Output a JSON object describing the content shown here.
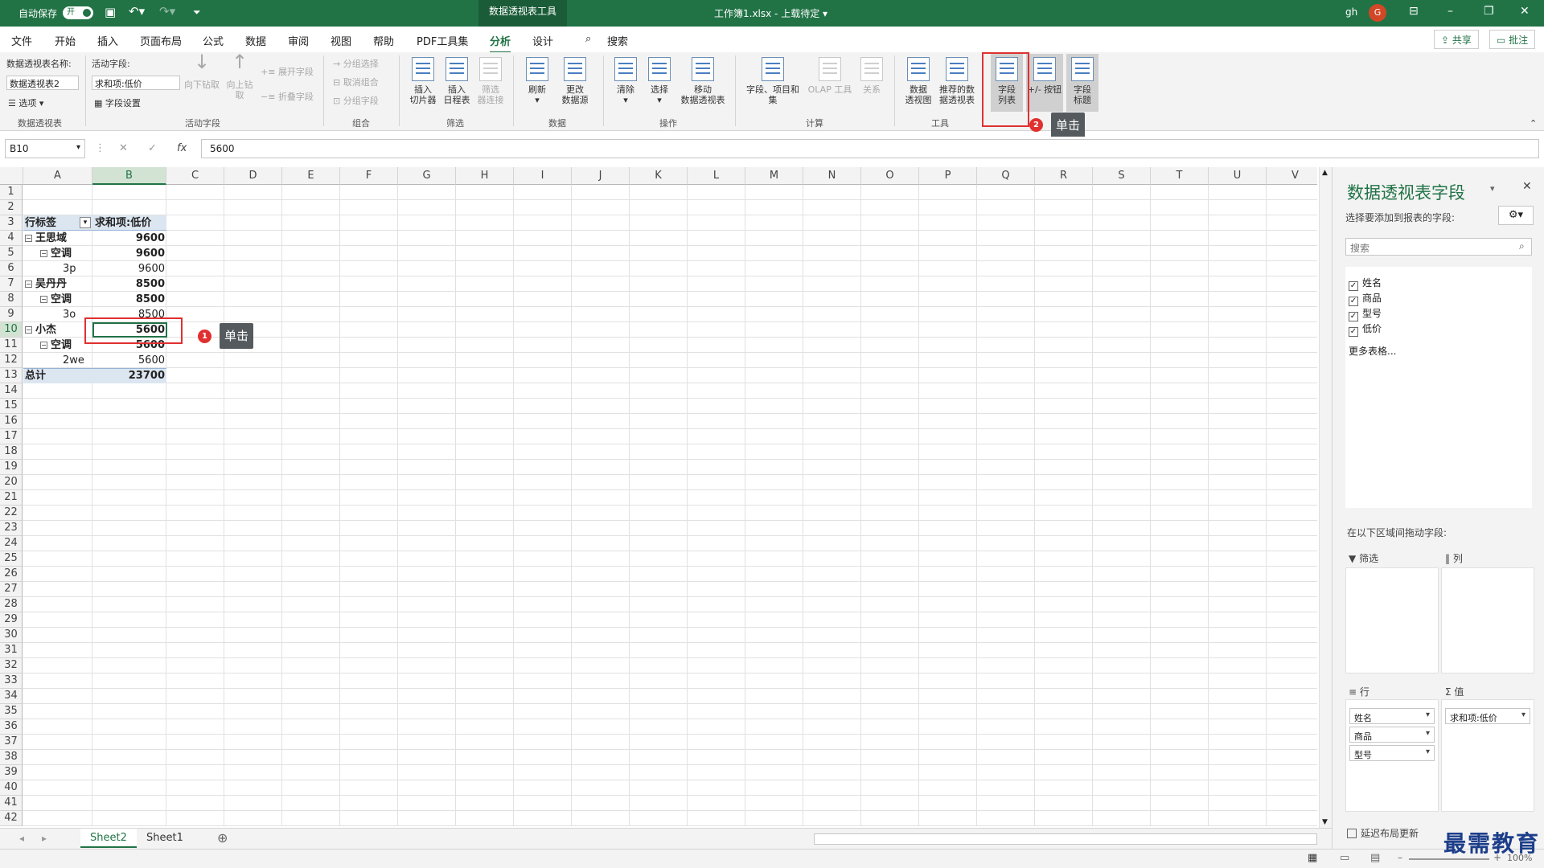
{
  "titlebar": {
    "autosave_label": "自动保存",
    "autosave_state": "开",
    "context_tab": "数据透视表工具",
    "document_title": "工作簿1.xlsx - 上载待定 ▾",
    "user_initials": "gh",
    "avatar_letter": "G"
  },
  "menu": {
    "tabs": [
      "文件",
      "开始",
      "插入",
      "页面布局",
      "公式",
      "数据",
      "审阅",
      "视图",
      "帮助",
      "PDF工具集",
      "分析",
      "设计"
    ],
    "active_tab": "分析",
    "search": "搜索",
    "share": "共享",
    "comment": "批注"
  },
  "ribbon": {
    "pt_name_label": "数据透视表名称:",
    "pt_name_value": "数据透视表2",
    "options": "选项",
    "active_field_label": "活动字段:",
    "active_field_value": "求和项:低价",
    "field_settings": "字段设置",
    "drill_down": "向下钻取",
    "drill_up_1": "向上钻",
    "drill_up_2": "取",
    "expand_field": "展开字段",
    "collapse_field": "折叠字段",
    "group_selection": "分组选择",
    "ungroup": "取消组合",
    "group_field": "分组字段",
    "insert_slicer": "插入\n切片器",
    "insert_timeline": "插入\n日程表",
    "filter_connections": "筛选\n器连接",
    "refresh": "刷新",
    "change_source": "更改\n数据源",
    "clear": "清除",
    "select": "选择",
    "move_pt": "移动\n数据透视表",
    "fields_items": "字段、项目和\n集",
    "olap": "OLAP 工具",
    "relations": "关系",
    "pivot_chart": "数据\n透视图",
    "recommended": "推荐的数\n据透视表",
    "field_list": "字段\n列表",
    "plus_minus": "+/- 按钮",
    "field_headers": "字段\n标题",
    "groups": [
      "数据透视表",
      "活动字段",
      "组合",
      "筛选",
      "数据",
      "操作",
      "计算",
      "工具"
    ]
  },
  "annotations": {
    "badge1": "1",
    "tip1": "单击",
    "badge2": "2",
    "tip2": "单击"
  },
  "formula_bar": {
    "name_box": "B10",
    "fx": "fx",
    "value": "5600"
  },
  "columns": [
    "A",
    "B",
    "C",
    "D",
    "E",
    "F",
    "G",
    "H",
    "I",
    "J",
    "K",
    "L",
    "M",
    "N",
    "O",
    "P",
    "Q",
    "R",
    "S",
    "T",
    "U",
    "V"
  ],
  "selected_column": "B",
  "selected_row": 10,
  "pivot": {
    "header_label": "行标签",
    "header_value": "求和项:低价",
    "rows": [
      {
        "label": "王思域",
        "value": "9600",
        "level": 0
      },
      {
        "label": "空调",
        "value": "9600",
        "level": 1
      },
      {
        "label": "3p",
        "value": "9600",
        "level": 2
      },
      {
        "label": "吴丹丹",
        "value": "8500",
        "level": 0
      },
      {
        "label": "空调",
        "value": "8500",
        "level": 1
      },
      {
        "label": "3o",
        "value": "8500",
        "level": 2
      },
      {
        "label": "小杰",
        "value": "5600",
        "level": 0
      },
      {
        "label": "空调",
        "value": "5600",
        "level": 1
      },
      {
        "label": "2we",
        "value": "5600",
        "level": 2
      }
    ],
    "total_label": "总计",
    "total_value": "23700"
  },
  "sheets": [
    "Sheet2",
    "Sheet1"
  ],
  "active_sheet": "Sheet2",
  "zoom": "100%",
  "panel": {
    "title": "数据透视表字段",
    "subtitle": "选择要添加到报表的字段:",
    "search_placeholder": "搜索",
    "fields": [
      "姓名",
      "商品",
      "型号",
      "低价"
    ],
    "more_tables": "更多表格...",
    "drag_hint": "在以下区域间拖动字段:",
    "filter_label": "筛选",
    "columns_label": "列",
    "rows_label": "行",
    "values_label": "值",
    "row_fields": [
      "姓名",
      "商品",
      "型号"
    ],
    "value_fields": [
      "求和项:低价"
    ],
    "defer_update": "延迟布局更新"
  },
  "watermark": "最需教育"
}
